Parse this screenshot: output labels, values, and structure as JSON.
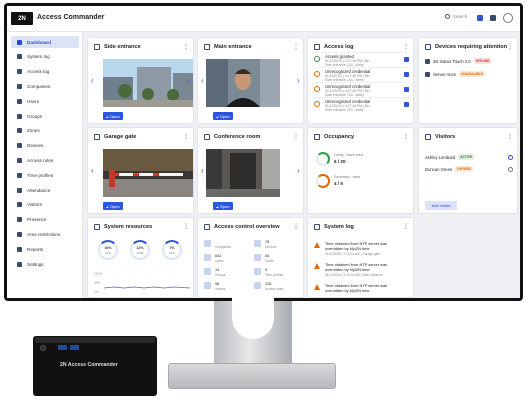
{
  "app": {
    "logo": "2N",
    "title": "Access Commander",
    "search_placeholder": "Search"
  },
  "sidebar": {
    "items": [
      {
        "label": "Dashboard",
        "icon": "dashboard-icon",
        "active": true
      },
      {
        "label": "System log",
        "icon": "system-log-icon"
      },
      {
        "label": "Access log",
        "icon": "access-log-icon"
      },
      {
        "label": "Companies",
        "icon": "companies-icon"
      },
      {
        "label": "Users",
        "icon": "users-icon"
      },
      {
        "label": "Groups",
        "icon": "groups-icon"
      },
      {
        "label": "Zones",
        "icon": "zones-icon"
      },
      {
        "label": "Devices",
        "icon": "devices-icon"
      },
      {
        "label": "Access rules",
        "icon": "access-rules-icon"
      },
      {
        "label": "Time profiles",
        "icon": "time-profiles-icon"
      },
      {
        "label": "Attendance",
        "icon": "attendance-icon"
      },
      {
        "label": "Visitors",
        "icon": "visitors-icon"
      },
      {
        "label": "Presence",
        "icon": "presence-icon"
      },
      {
        "label": "Area restrictions",
        "icon": "area-restrictions-icon"
      },
      {
        "label": "Reports",
        "icon": "reports-icon"
      },
      {
        "label": "Settings",
        "icon": "settings-icon"
      }
    ]
  },
  "cameras": [
    {
      "title": "Side entrance",
      "open": "Open"
    },
    {
      "title": "Main entrance",
      "open": "Open"
    },
    {
      "title": "Garage gate",
      "open": "Open"
    },
    {
      "title": "Conference room",
      "open": "Open"
    }
  ],
  "access_log": {
    "title": "Access log",
    "entries": [
      {
        "status": "Access granted",
        "time": "01/12/2024 | 4:27:46 PM | Be...",
        "where": "Side entrance | A3 - lobby",
        "ok": true
      },
      {
        "status": "Unrecognized credential",
        "time": "01/12/2024 | 4:27:46 PM | Be...",
        "where": "Side entrance | A3 - lobby",
        "ok": false
      },
      {
        "status": "Unrecognized credential",
        "time": "01/12/2024 | 4:27:46 PM | Be...",
        "where": "Side entrance | A3 - lobby",
        "ok": false
      },
      {
        "status": "Unrecognized credential",
        "time": "01/12/2024 | 4:27:46 PM | Be...",
        "where": "Side entrance | A3 - lobby",
        "ok": false
      }
    ]
  },
  "devices": {
    "title": "Devices requiring attention",
    "items": [
      {
        "name": "2N Indoor Touch 2.0",
        "badge": "OFFLINE",
        "color": "#d93025"
      },
      {
        "name": "Server room",
        "badge": "UNAVAILABLE",
        "color": "#e26a00"
      }
    ]
  },
  "occupancy": {
    "title": "Occupancy",
    "zones": [
      {
        "name": "Lobby - back area",
        "value": "6 / 20"
      },
      {
        "name": "Secretary - area",
        "value": "4 / 5"
      }
    ]
  },
  "visitors": {
    "title": "Visitors",
    "add": "Add visitor",
    "items": [
      {
        "name": "Ashley Lombard",
        "badge": "ACTIVE",
        "color": "#2e7d32"
      },
      {
        "name": "Duncan Green",
        "badge": "EXPIRED",
        "color": "#e26a00"
      }
    ]
  },
  "system_resources": {
    "title": "System resources",
    "gauges": [
      {
        "value": "16%",
        "label": "CPU"
      },
      {
        "value": "12%",
        "label": "RAM"
      },
      {
        "value": "7%",
        "label": "CPU"
      }
    ],
    "scale": [
      "100%",
      "50%",
      "0%"
    ]
  },
  "overview": {
    "title": "Access control overview",
    "items": [
      {
        "num": "",
        "label": "Companies"
      },
      {
        "num": "78",
        "label": "Devices"
      },
      {
        "num": "642",
        "label": "Users"
      },
      {
        "num": "54",
        "label": "Zones"
      },
      {
        "num": "14",
        "label": "Groups"
      },
      {
        "num": "9",
        "label": "Time profiles"
      },
      {
        "num": "96",
        "label": "Visitors"
      },
      {
        "num": "128",
        "label": "Access rules"
      }
    ]
  },
  "system_log": {
    "title": "System log",
    "entries": [
      {
        "text": "Time obtained from NTP server was overridden by MyIZN time",
        "date": "01/12/2024 | 7:12:01 AM | Garage gate"
      },
      {
        "text": "Time obtained from NTP server was overridden by MyIZN time",
        "date": "01/12/2024 | 7:12:01 AM | Main entrance"
      },
      {
        "text": "Time obtained from NTP server was overridden by MyIZN time",
        "date": ""
      }
    ]
  },
  "hardware": {
    "label": "2N Access Commander"
  }
}
